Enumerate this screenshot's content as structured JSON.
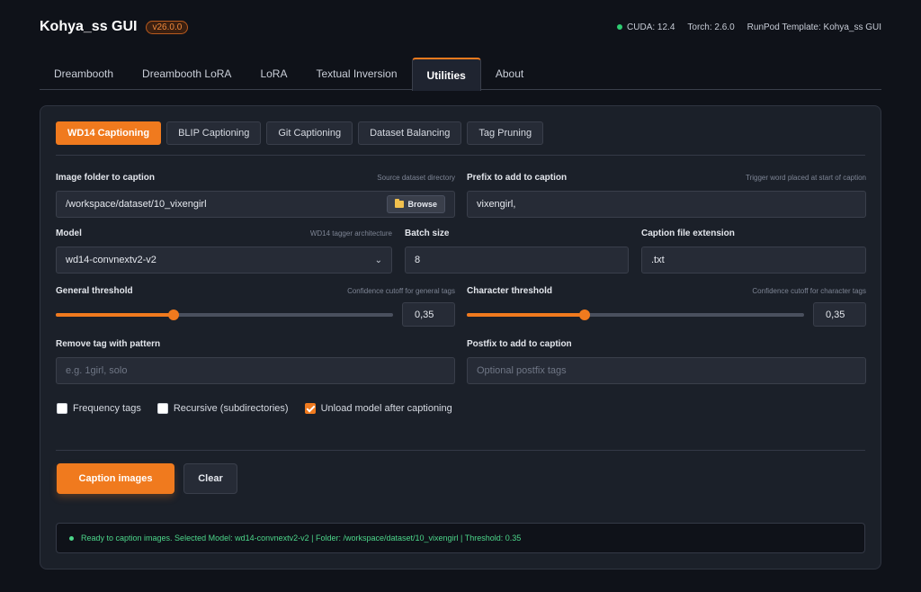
{
  "header": {
    "title": "Kohya_ss GUI",
    "version": "v26.0.0",
    "cuda": "CUDA: 12.4",
    "torch": "Torch: 2.6.0",
    "template": "RunPod Template: Kohya_ss GUI",
    "status_color": "#2ecc71"
  },
  "main_tabs": [
    "Dreambooth",
    "Dreambooth LoRA",
    "LoRA",
    "Textual Inversion",
    "Utilities",
    "About"
  ],
  "active_main_tab": "Utilities",
  "sub_tabs": [
    "WD14 Captioning",
    "BLIP Captioning",
    "Git Captioning",
    "Dataset Balancing",
    "Tag Pruning"
  ],
  "active_sub_tab": "WD14 Captioning",
  "form": {
    "image_folder": {
      "label": "Image folder to caption",
      "hint": "Source dataset directory",
      "value": "/workspace/dataset/10_vixengirl",
      "browse_label": "Browse",
      "browse_icon": "folder-icon"
    },
    "prefix": {
      "label": "Prefix to add to caption",
      "hint": "Trigger word placed at start of caption",
      "value": "vixengirl,"
    },
    "model": {
      "label": "Model",
      "hint": "WD14 tagger architecture",
      "value": "wd14-convnextv2-v2"
    },
    "batch_size": {
      "label": "Batch size",
      "value": "8"
    },
    "caption_ext": {
      "label": "Caption file extension",
      "value": ".txt"
    },
    "general_threshold": {
      "label": "General threshold",
      "hint": "Confidence cutoff for general tags",
      "value": "0,35",
      "level": 0.35
    },
    "character_threshold": {
      "label": "Character threshold",
      "hint": "Confidence cutoff for character tags",
      "value": "0,35",
      "level": 0.35
    },
    "remove_tag": {
      "label": "Remove tag with pattern",
      "placeholder": "e.g. 1girl, solo"
    },
    "postfix": {
      "label": "Postfix to add to caption",
      "placeholder": "Optional postfix tags"
    }
  },
  "checkboxes": [
    {
      "label": "Frequency tags",
      "checked": false
    },
    {
      "label": "Recursive (subdirectories)",
      "checked": false
    },
    {
      "label": "Unload model after captioning",
      "checked": true
    }
  ],
  "actions": {
    "primary": "Caption images",
    "secondary": "Clear"
  },
  "status": "Ready to caption images. Selected Model: wd14-convnextv2-v2 | Folder: /workspace/dataset/10_vixengirl | Threshold: 0.35",
  "colors": {
    "accent": "#f07a1e",
    "success": "#4cd68a",
    "background": "#0f1219",
    "panel": "#1b2029"
  }
}
